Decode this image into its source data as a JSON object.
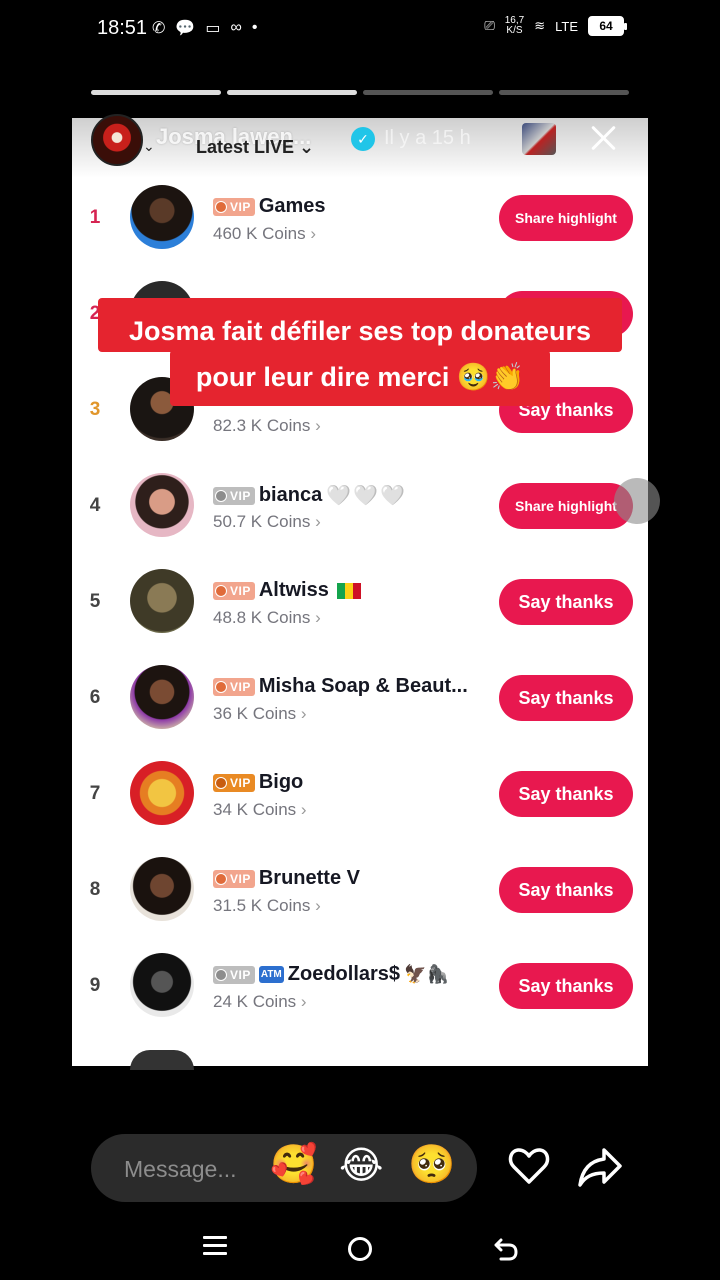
{
  "status_bar": {
    "time": "18:51",
    "net_speed_value": "16,7",
    "net_speed_unit": "K/S",
    "network": "LTE",
    "battery": "64"
  },
  "story": {
    "username": "Josma lawen...",
    "time_ago": "Il y a 15 h",
    "progress_total": 4,
    "progress_done": 2
  },
  "board": {
    "header_label": "Latest LIVE",
    "rows": [
      {
        "rank": "1",
        "badge": "VIP",
        "name": "Games",
        "coins": "460 K Coins",
        "action": "Share highlight"
      },
      {
        "rank": "2",
        "badge": "",
        "name": "",
        "coins": "",
        "action": ""
      },
      {
        "rank": "3",
        "badge": "",
        "name": "",
        "coins": "82.3 K Coins",
        "action": "Say thanks"
      },
      {
        "rank": "4",
        "badge": "VIP",
        "name": "bianca",
        "name_suffix": "🤍🤍🤍",
        "coins": "50.7 K Coins",
        "action": "Share highlight"
      },
      {
        "rank": "5",
        "badge": "VIP",
        "name": "Altwiss",
        "coins": "48.8 K Coins",
        "action": "Say thanks"
      },
      {
        "rank": "6",
        "badge": "VIP",
        "name": "Misha Soap & Beaut...",
        "coins": "36 K Coins",
        "action": "Say thanks"
      },
      {
        "rank": "7",
        "badge": "VIP",
        "name": "Bigo",
        "coins": "34 K Coins",
        "action": "Say thanks"
      },
      {
        "rank": "8",
        "badge": "VIP",
        "name": "Brunette V",
        "coins": "31.5 K Coins",
        "action": "Say thanks"
      },
      {
        "rank": "9",
        "badge": "VIP",
        "name_prefix": "ATM",
        "name": "Zoedollars$",
        "name_suffix": "🦅🦍",
        "coins": "24 K Coins",
        "action": "Say thanks"
      }
    ]
  },
  "caption": {
    "line1": "Josma fait défiler ses top donateurs",
    "line2": "pour leur dire merci 🥹👏"
  },
  "message_bar": {
    "placeholder": "Message...",
    "emoji_1": "🥰",
    "emoji_2": "😂",
    "emoji_3": "🥺"
  },
  "icons": {
    "close": "close-icon",
    "heart": "heart-icon",
    "share": "share-icon",
    "verified": "verified-icon"
  },
  "colors": {
    "accent": "#e8184f",
    "caption_bg": "#e5242f",
    "verified": "#20c5e8"
  }
}
